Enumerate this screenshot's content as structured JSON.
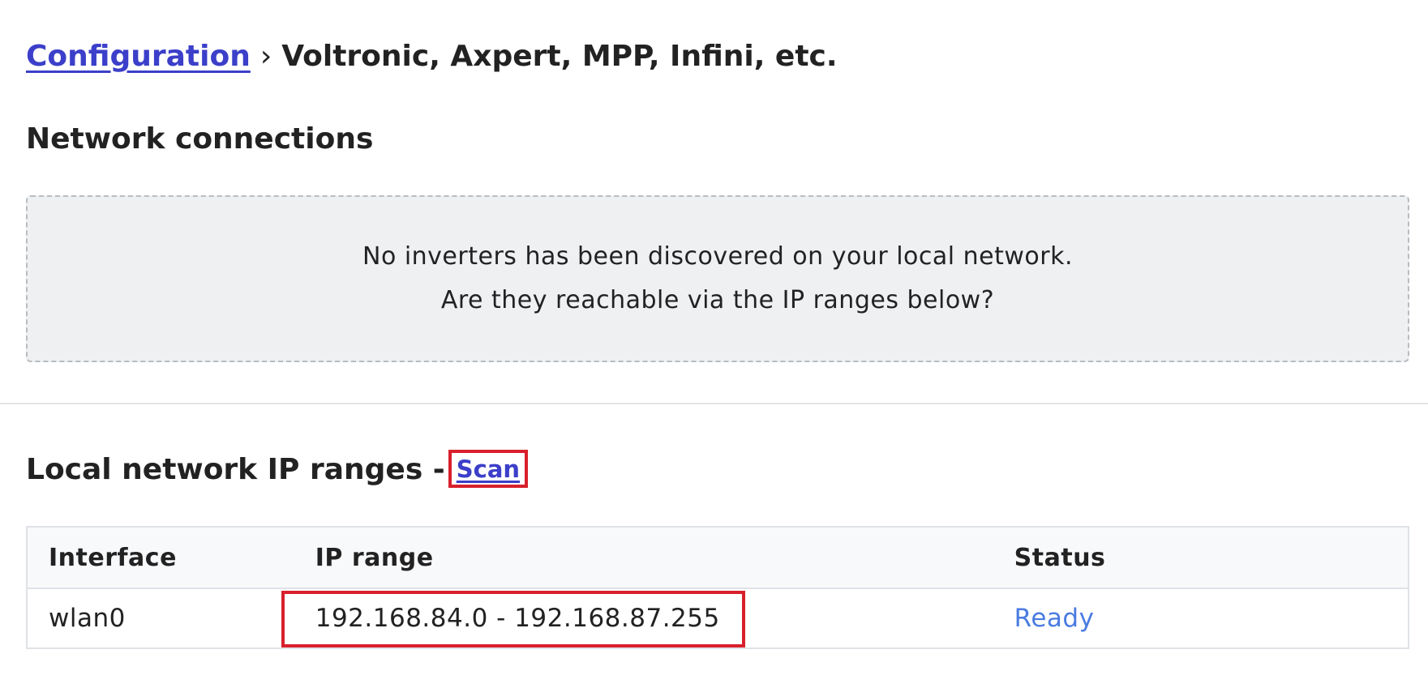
{
  "breadcrumb": {
    "parent_label": "Configuration",
    "separator": "›",
    "current_label": "Voltronic, Axpert, MPP, Infini, etc."
  },
  "network_connections": {
    "title": "Network connections",
    "empty_message_line1": "No inverters has been discovered on your local network.",
    "empty_message_line2": "Are they reachable via the IP ranges below?"
  },
  "ip_ranges": {
    "title": "Local network IP ranges",
    "dash": " -",
    "scan_label": "Scan",
    "columns": {
      "interface": "Interface",
      "ip_range": "IP range",
      "status": "Status"
    },
    "rows": [
      {
        "interface": "wlan0",
        "ip_range": "192.168.84.0 - 192.168.87.255",
        "status": "Ready"
      }
    ]
  },
  "colors": {
    "link": "#3b3fc9",
    "status_ready": "#4a7be0",
    "highlight_box": "#d8202c",
    "empty_box_bg": "#eef0f2"
  }
}
